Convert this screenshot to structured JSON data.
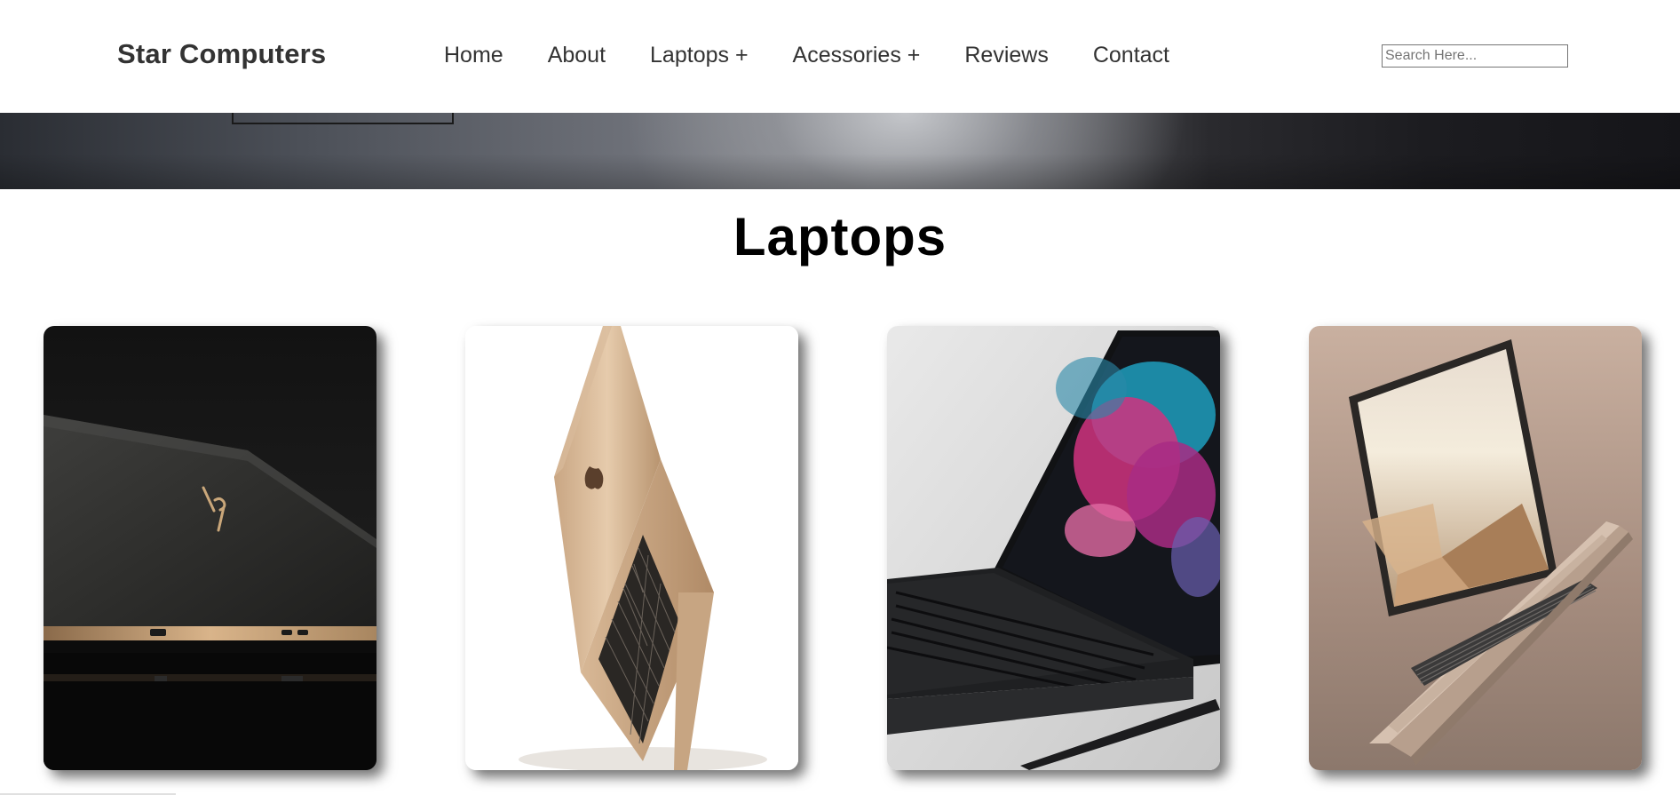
{
  "header": {
    "brand": "Star Computers",
    "nav": [
      {
        "label": "Home"
      },
      {
        "label": "About"
      },
      {
        "label": "Laptops +"
      },
      {
        "label": "Acessories +"
      },
      {
        "label": "Reviews"
      },
      {
        "label": "Contact"
      }
    ],
    "search": {
      "placeholder": "Search Here...",
      "value": ""
    }
  },
  "main": {
    "section_title": "Laptops",
    "cards": [
      {
        "name": "hp-spectre-laptop-image"
      },
      {
        "name": "gold-macbook-laptop-image"
      },
      {
        "name": "surface-pro-laptop-image"
      },
      {
        "name": "rose-gold-laptop-image"
      }
    ]
  },
  "colors": {
    "text": "#333333",
    "title": "#000000",
    "background": "#ffffff"
  }
}
